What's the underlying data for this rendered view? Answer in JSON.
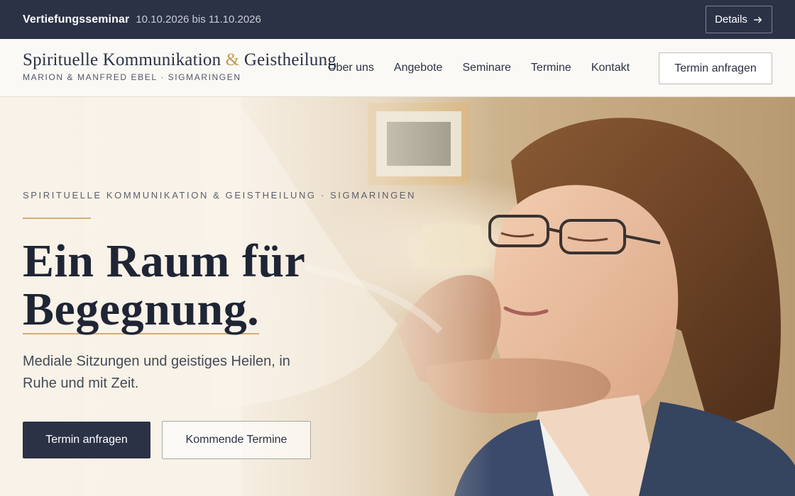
{
  "announcement": {
    "title": "Vertiefungsseminar",
    "dates": "10.10.2026 bis 11.10.2026",
    "details_label": "Details"
  },
  "brand": {
    "name_part1": "Spirituelle Kommunikation",
    "name_amp": "&",
    "name_part2": "Geistheilung",
    "subtitle": "MARION & MANFRED EBEL · SIGMARINGEN"
  },
  "nav": {
    "items": [
      {
        "label": "Über uns"
      },
      {
        "label": "Angebote"
      },
      {
        "label": "Seminare"
      },
      {
        "label": "Termine"
      },
      {
        "label": "Kontakt"
      }
    ],
    "cta_label": "Termin anfragen"
  },
  "hero": {
    "kicker": "SPIRITUELLE KOMMUNIKATION & GEISTHEILUNG · SIGMARINGEN",
    "headline_line1": "Ein Raum für",
    "headline_line2": "Begegnung.",
    "lead": "Mediale Sitzungen und geistiges Heilen, in Ruhe und mit Zeit.",
    "primary_label": "Termin anfragen",
    "secondary_label": "Kommende Termine"
  },
  "colors": {
    "navy": "#2b3246",
    "gold": "#c29b52",
    "cream": "#f7f4ee"
  }
}
